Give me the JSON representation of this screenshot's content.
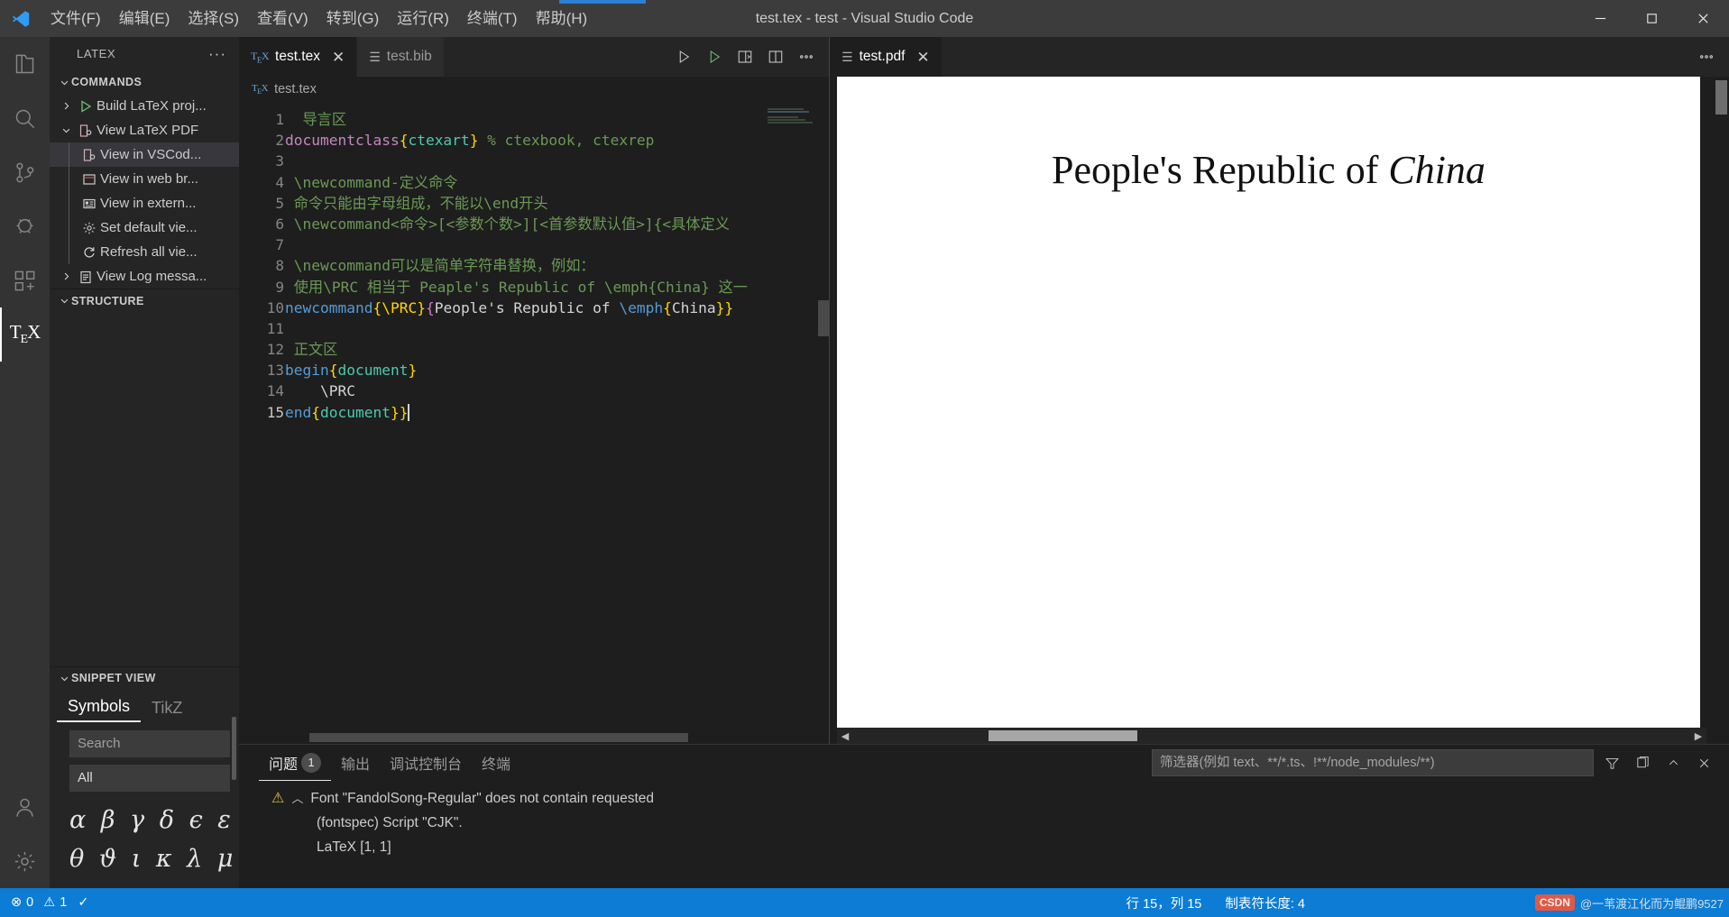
{
  "titlebar": {
    "window_title": "test.tex - test - Visual Studio Code",
    "menus": [
      "文件(F)",
      "编辑(E)",
      "选择(S)",
      "查看(V)",
      "转到(G)",
      "运行(R)",
      "终端(T)",
      "帮助(H)"
    ],
    "controls": [
      "minimize",
      "maximize",
      "close"
    ]
  },
  "activitybar": {
    "items": [
      {
        "name": "explorer",
        "icon": "files-icon"
      },
      {
        "name": "search",
        "icon": "search-icon"
      },
      {
        "name": "source-control",
        "icon": "source-control-icon"
      },
      {
        "name": "run-debug",
        "icon": "run-debug-icon"
      },
      {
        "name": "extensions",
        "icon": "extensions-icon"
      },
      {
        "name": "latex",
        "icon": "tex-icon",
        "label": "TEX",
        "active": true
      }
    ],
    "bottom": [
      {
        "name": "accounts",
        "icon": "account-icon"
      },
      {
        "name": "settings",
        "icon": "gear-icon"
      }
    ]
  },
  "sidebar": {
    "title": "LATEX",
    "more_label": "···",
    "sections": [
      {
        "name": "commands",
        "label": "COMMANDS",
        "expanded": true,
        "items": [
          {
            "label": "Build LaTeX proj...",
            "icon": "play-icon",
            "twisty": "collapsed",
            "indent": 1
          },
          {
            "label": "View LaTeX PDF",
            "icon": "view-pdf-icon",
            "twisty": "expanded",
            "indent": 1
          },
          {
            "label": "View in VSCod...",
            "icon": "view-pdf-icon",
            "twisty": "none",
            "indent": 2,
            "selected": true
          },
          {
            "label": "View in web br...",
            "icon": "browser-icon",
            "twisty": "none",
            "indent": 2
          },
          {
            "label": "View in extern...",
            "icon": "external-icon",
            "twisty": "none",
            "indent": 2
          },
          {
            "label": "Set default vie...",
            "icon": "gear-icon",
            "twisty": "none",
            "indent": 2
          },
          {
            "label": "Refresh all vie...",
            "icon": "refresh-icon",
            "twisty": "none",
            "indent": 2
          },
          {
            "label": "View Log messa...",
            "icon": "log-icon",
            "twisty": "collapsed",
            "indent": 1
          }
        ]
      },
      {
        "name": "structure",
        "label": "STRUCTURE",
        "expanded": true,
        "items": []
      },
      {
        "name": "snippet-view",
        "label": "SNIPPET VIEW",
        "expanded": true,
        "tabs": [
          {
            "label": "Symbols",
            "active": true
          },
          {
            "label": "TikZ",
            "active": false
          }
        ],
        "search_placeholder": "Search",
        "all_label": "All",
        "symbol_rows": [
          "α β γ δ ϵ ε ζ η",
          "θ ϑ ι κ λ μ ν ξ"
        ]
      }
    ]
  },
  "editor": {
    "tabs": [
      {
        "label": "test.tex",
        "icon": "tex-file-icon",
        "active": true,
        "closable": true
      },
      {
        "label": "test.bib",
        "icon": "bib-file-icon",
        "active": false,
        "closable": false
      }
    ],
    "actions": [
      {
        "name": "run-latex",
        "icon": "play-outline-icon"
      },
      {
        "name": "build-latex",
        "icon": "play-green-icon"
      },
      {
        "name": "split-editor-pdf",
        "icon": "open-preview-icon"
      },
      {
        "name": "split-editor-right",
        "icon": "split-editor-icon"
      },
      {
        "name": "more-actions",
        "icon": "ellipsis-icon"
      }
    ],
    "breadcrumb": "test.tex",
    "lines": [
      {
        "n": 1,
        "tokens": [
          {
            "t": "  导言区",
            "c": "cm"
          }
        ]
      },
      {
        "n": 2,
        "tokens": [
          {
            "t": "documentclass",
            "c": "kw"
          },
          {
            "t": "{",
            "c": "br"
          },
          {
            "t": "ctexart",
            "c": "cls"
          },
          {
            "t": "}",
            "c": "br"
          },
          {
            "t": " % ctexbook, ctexrep",
            "c": "cm"
          }
        ]
      },
      {
        "n": 3,
        "tokens": []
      },
      {
        "n": 4,
        "tokens": [
          {
            "t": " \\newcommand-定义命令",
            "c": "cm"
          }
        ]
      },
      {
        "n": 5,
        "tokens": [
          {
            "t": " 命令只能由字母组成，不能以\\end开头",
            "c": "cm"
          }
        ]
      },
      {
        "n": 6,
        "tokens": [
          {
            "t": " \\newcommand<命令>[<参数个数>][<首参数默认值>]{<具体定义",
            "c": "cm"
          }
        ]
      },
      {
        "n": 7,
        "tokens": []
      },
      {
        "n": 8,
        "tokens": [
          {
            "t": " \\newcommand可以是简单字符串替换，例如：",
            "c": "cm"
          }
        ]
      },
      {
        "n": 9,
        "tokens": [
          {
            "t": " 使用\\PRC 相当于 Peaple's Republic of \\emph{China} 这一",
            "c": "cm"
          }
        ]
      },
      {
        "n": 10,
        "tokens": [
          {
            "t": "newcommand",
            "c": "cmd"
          },
          {
            "t": "{",
            "c": "br"
          },
          {
            "t": "\\PRC",
            "c": "br"
          },
          {
            "t": "}",
            "c": "br"
          },
          {
            "t": "{",
            "c": "br2"
          },
          {
            "t": "People's Republic of ",
            "c": "str"
          },
          {
            "t": "\\emph",
            "c": "cmd"
          },
          {
            "t": "{",
            "c": "br"
          },
          {
            "t": "China",
            "c": "str"
          },
          {
            "t": "}}",
            "c": "br"
          }
        ]
      },
      {
        "n": 11,
        "tokens": []
      },
      {
        "n": 12,
        "tokens": [
          {
            "t": " 正文区",
            "c": "cm"
          }
        ]
      },
      {
        "n": 13,
        "tokens": [
          {
            "t": "begin",
            "c": "cmd"
          },
          {
            "t": "{",
            "c": "br"
          },
          {
            "t": "document",
            "c": "cls"
          },
          {
            "t": "}",
            "c": "br"
          }
        ]
      },
      {
        "n": 14,
        "tokens": [
          {
            "t": "    \\PRC",
            "c": "str"
          }
        ]
      },
      {
        "n": 15,
        "tokens": [
          {
            "t": "end",
            "c": "cmd"
          },
          {
            "t": "{",
            "c": "br"
          },
          {
            "t": "document",
            "c": "cls"
          },
          {
            "t": "}}",
            "c": "br"
          }
        ],
        "cursor": true
      }
    ]
  },
  "pdf": {
    "tabs": [
      {
        "label": "test.pdf",
        "icon": "pdf-file-icon",
        "active": true,
        "closable": true
      }
    ],
    "more_label": "···",
    "content_title_plain": "People's Republic of ",
    "content_title_italic": "China"
  },
  "panel": {
    "tabs": [
      {
        "label": "问题",
        "badge": "1",
        "active": true
      },
      {
        "label": "输出",
        "active": false
      },
      {
        "label": "调试控制台",
        "active": false
      },
      {
        "label": "终端",
        "active": false
      }
    ],
    "filter_placeholder": "筛选器(例如 text、**/*.ts、!**/node_modules/**)",
    "actions": [
      {
        "name": "filter-icon"
      },
      {
        "name": "clear-filters-icon"
      },
      {
        "name": "maximize-panel-icon"
      },
      {
        "name": "close-panel-icon"
      }
    ],
    "problems": [
      {
        "severity": "warning",
        "text": "Font \"FandolSong-Regular\" does not contain requested"
      },
      {
        "indent": true,
        "text": "(fontspec) Script \"CJK\"."
      },
      {
        "indent": true,
        "text": "LaTeX [1, 1]"
      }
    ]
  },
  "statusbar": {
    "errors": "0",
    "warnings": "1",
    "check_icon": "✓",
    "position": "行 15，列 15",
    "tab_size": "制表符长度: 4",
    "watermark_badge": "CSDN",
    "watermark_text": "@一苇渡江化而为鲲鹏9527"
  }
}
